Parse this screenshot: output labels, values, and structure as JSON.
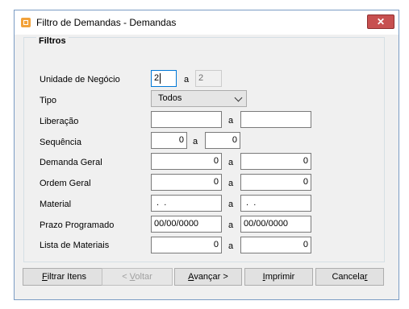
{
  "window": {
    "title": "Filtro de Demandas - Demandas",
    "close_glyph": "✕"
  },
  "group": {
    "legend": "Filtros"
  },
  "form": {
    "unidade": {
      "label": "Unidade de Negócio",
      "from": "2",
      "sep": "a",
      "to": "2"
    },
    "tipo": {
      "label": "Tipo",
      "selected": "Todos"
    },
    "liberacao": {
      "label": "Liberação",
      "from": "",
      "sep": "a",
      "to": ""
    },
    "sequencia": {
      "label": "Sequência",
      "from": "0",
      "sep": "a",
      "to": "0"
    },
    "demanda_geral": {
      "label": "Demanda Geral",
      "from": "0",
      "sep": "a",
      "to": "0"
    },
    "ordem_geral": {
      "label": "Ordem Geral",
      "from": "0",
      "sep": "a",
      "to": "0"
    },
    "material": {
      "label": "Material",
      "from": " .  .",
      "sep": "a",
      "to": " .  ."
    },
    "prazo": {
      "label": "Prazo Programado",
      "from": "00/00/0000",
      "sep": "a",
      "to": "00/00/0000"
    },
    "lista": {
      "label": "Lista de Materiais",
      "from": "0",
      "sep": "a",
      "to": "0"
    }
  },
  "buttons": {
    "filtrar": {
      "mn": "F",
      "rest": "iltrar Itens"
    },
    "voltar": {
      "pre": "< ",
      "mn": "V",
      "rest": "oltar"
    },
    "avancar": {
      "mn": "A",
      "rest": "vançar >"
    },
    "imprimir": {
      "mn": "I",
      "rest": "mprimir"
    },
    "cancelar": {
      "pre": "Cancela",
      "mn": "r"
    }
  }
}
